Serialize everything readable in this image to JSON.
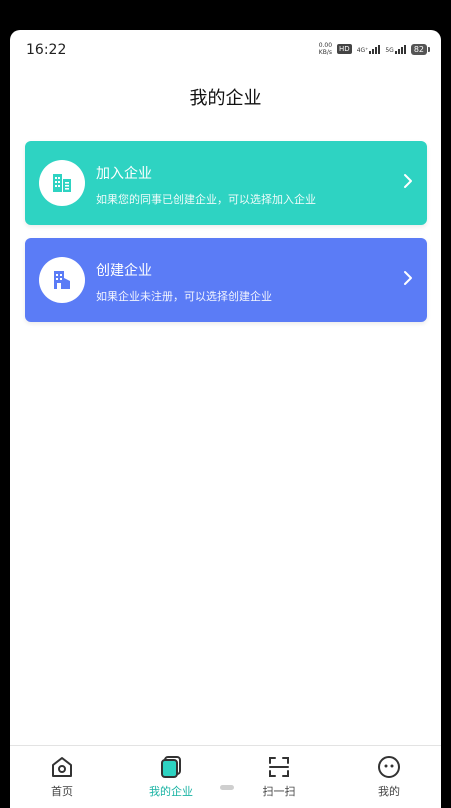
{
  "status_bar": {
    "time": "16:22",
    "net_speed_value": "0.00",
    "net_speed_unit": "KB/s",
    "hd_label": "HD",
    "signal_1_label": "4G⁺",
    "signal_2_label": "5G",
    "battery": "82"
  },
  "page": {
    "title": "我的企业"
  },
  "cards": {
    "join": {
      "title": "加入企业",
      "description": "如果您的同事已创建企业，可以选择加入企业",
      "color": "#2ed3c2",
      "icon": "buildings-icon"
    },
    "create": {
      "title": "创建企业",
      "description": "如果企业未注册，可以选择创建企业",
      "color": "#5b7cf6",
      "icon": "factory-icon"
    }
  },
  "tabbar": {
    "items": [
      {
        "label": "首页",
        "icon": "home-icon"
      },
      {
        "label": "我的企业",
        "icon": "enterprise-icon",
        "active": true
      },
      {
        "label": "扫一扫",
        "icon": "scan-icon"
      },
      {
        "label": "我的",
        "icon": "profile-icon"
      }
    ],
    "active_color": "#19b3a3"
  }
}
